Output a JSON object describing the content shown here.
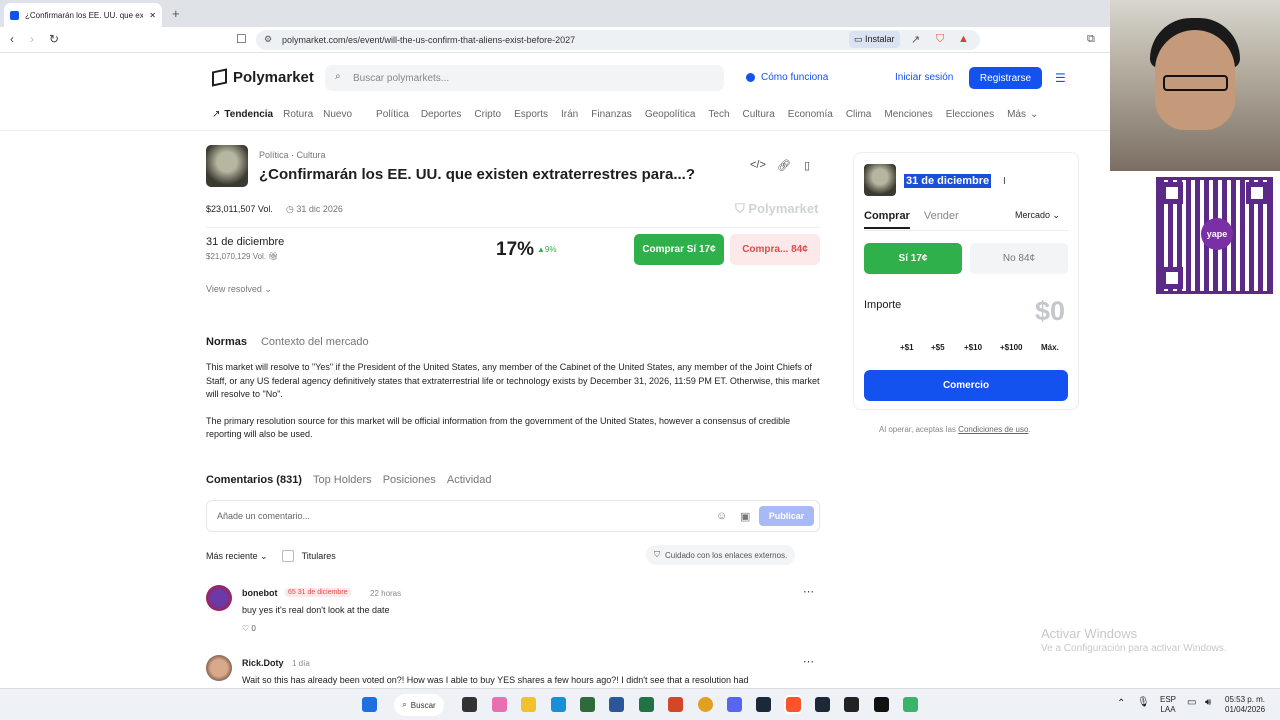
{
  "browser": {
    "tab_title": "¿Confirmarán los EE. UU. que existen...",
    "url": "polymarket.com/es/event/will-the-us-confirm-that-aliens-exist-before-2027",
    "install_label": "Instalar"
  },
  "header": {
    "brand": "Polymarket",
    "search_placeholder": "Buscar polymarkets...",
    "how_it_works": "Cómo funciona",
    "login": "Iniciar sesión",
    "signup": "Registrarse"
  },
  "categories": [
    "Tendencia",
    "Rotura",
    "Nuevo",
    "Política",
    "Deportes",
    "Cripto",
    "Esports",
    "Irán",
    "Finanzas",
    "Geopolítica",
    "Tech",
    "Cultura",
    "Economía",
    "Clima",
    "Menciones",
    "Elecciones",
    "Más"
  ],
  "market": {
    "category1": "Política",
    "category2": "Cultura",
    "title": "¿Confirmarán los EE. UU. que existen extraterrestres para...?",
    "volume": "$23,011,507 Vol.",
    "end_date": "31 dic 2026",
    "watermark": "Polymarket",
    "outcome_label": "31 de diciembre",
    "outcome_volume": "$21,070,129 Vol.",
    "probability": "17%",
    "probability_change": "9%",
    "buy_yes": "Comprar Sí 17¢",
    "buy_no": "Compra... 84¢",
    "view_resolved": "View resolved"
  },
  "rules": {
    "tab_rules": "Normas",
    "tab_context": "Contexto del mercado",
    "paragraph1": "This market will resolve to \"Yes\" if the President of the United States, any member of the Cabinet of the United States, any member of the Joint Chiefs of Staff, or any US federal agency definitively states that extraterrestrial life or technology exists by December 31, 2026, 11:59 PM ET. Otherwise, this market will resolve to \"No\".",
    "paragraph2": "The primary resolution source for this market will be official information from the government of the United States, however a consensus of credible reporting will also be used."
  },
  "comments": {
    "tabs": [
      "Comentarios (831)",
      "Top Holders",
      "Posiciones",
      "Actividad"
    ],
    "input_placeholder": "Añade un comentario...",
    "publish": "Publicar",
    "sort": "Más reciente",
    "holders_filter": "Titulares",
    "warning": "Cuidado con los enlaces externos.",
    "items": [
      {
        "user": "bonebot",
        "badge": "65 31 de diciembre",
        "time": "22 horas",
        "text": "buy yes it's real don't look at the date",
        "likes": "0"
      },
      {
        "user": "Rick.Doty",
        "time": "1 día",
        "text": "Wait so this has already been voted on?! How was I able to buy YES shares a few hours ago?!  I didn't see that a resolution had"
      }
    ]
  },
  "trade_panel": {
    "selected_outcome": "31 de diciembre",
    "tab_buy": "Comprar",
    "tab_sell": "Vender",
    "order_type": "Mercado",
    "yes": "Sí 17¢",
    "no": "No 84¢",
    "amount_label": "Importe",
    "amount_value": "$0",
    "quick_amounts": [
      "+$1",
      "+$5",
      "+$10",
      "+$100",
      "Máx."
    ],
    "trade_button": "Comercio",
    "terms_prefix": "Al operar, aceptas las",
    "terms_link": "Condiciones de uso",
    "terms_suffix": "."
  },
  "overlay": {
    "qr_brand": "yape",
    "activate_title": "Activar Windows",
    "activate_sub": "Ve a Configuración para activar Windows."
  },
  "taskbar": {
    "search": "Buscar",
    "lang1": "ESP",
    "lang2": "LAA",
    "time": "05:53 p. m.",
    "date": "01/04/2026"
  },
  "colors": {
    "brand_blue": "#1452f0",
    "yes_green": "#2fb04a",
    "no_red": "#e34948"
  }
}
